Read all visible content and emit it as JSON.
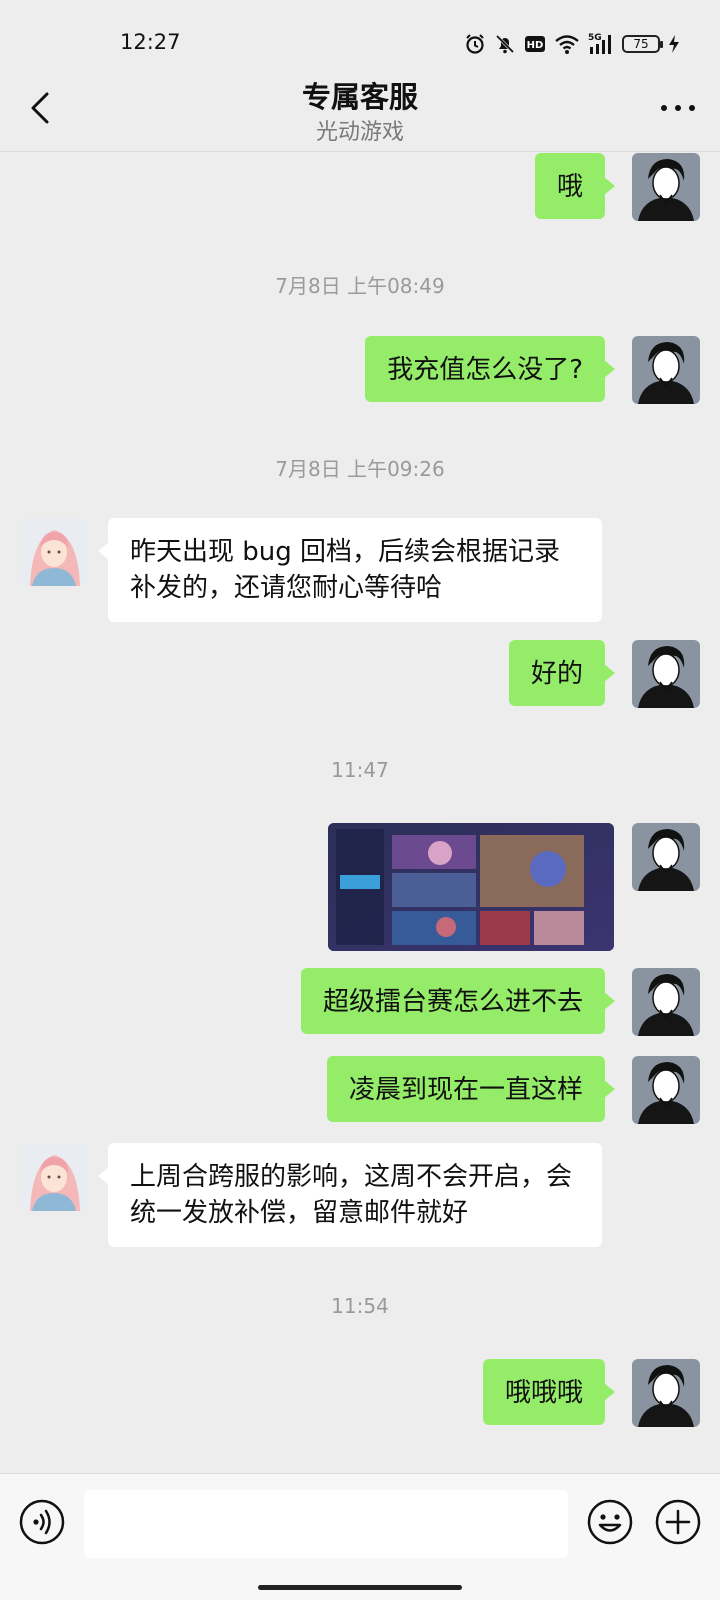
{
  "status_bar": {
    "time": "12:27",
    "network": "5G",
    "hd_label": "HD",
    "battery": "75",
    "icons": [
      "alarm-icon",
      "mute-icon",
      "hd-icon",
      "wifi-icon",
      "signal-icon",
      "battery-icon",
      "charging-icon"
    ]
  },
  "header": {
    "title": "专属客服",
    "subtitle": "光动游戏",
    "back_icon": "chevron-left-icon",
    "more_icon": "more-dots-icon"
  },
  "messages": [
    {
      "side": "me",
      "type": "text",
      "text": "哦"
    },
    {
      "type": "time",
      "text": "7月8日 上午08:49"
    },
    {
      "side": "me",
      "type": "text",
      "text": "我充值怎么没了?"
    },
    {
      "type": "time",
      "text": "7月8日 上午09:26"
    },
    {
      "side": "them",
      "type": "text",
      "text": "昨天出现 bug 回档，后续会根据记录补发的，还请您耐心等待哈"
    },
    {
      "side": "me",
      "type": "text",
      "text": "好的"
    },
    {
      "type": "time",
      "text": "11:47"
    },
    {
      "side": "me",
      "type": "image",
      "text": "game-screenshot"
    },
    {
      "side": "me",
      "type": "text",
      "text": "超级擂台赛怎么进不去"
    },
    {
      "side": "me",
      "type": "text",
      "text": "凌晨到现在一直这样"
    },
    {
      "side": "them",
      "type": "text",
      "text": "上周合跨服的影响，这周不会开启，会统一发放补偿，留意邮件就好"
    },
    {
      "type": "time",
      "text": "11:54"
    },
    {
      "side": "me",
      "type": "text",
      "text": "哦哦哦"
    }
  ],
  "input_bar": {
    "value": "",
    "placeholder": "",
    "voice_icon": "voice-icon",
    "emoji_icon": "emoji-icon",
    "add_icon": "plus-icon"
  },
  "colors": {
    "background": "#ededed",
    "my_bubble": "#95ec69",
    "their_bubble": "#ffffff"
  }
}
